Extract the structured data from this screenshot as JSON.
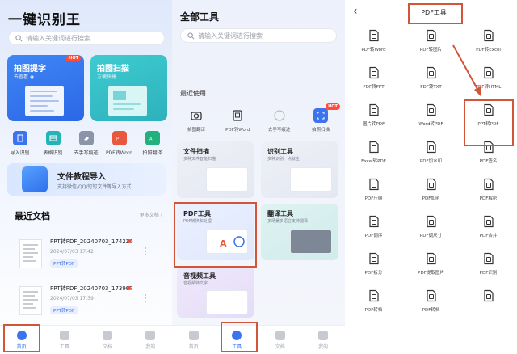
{
  "panel1": {
    "app_title": "一键识别王",
    "search_placeholder": "请输入关键词进行搜索",
    "card_photo": {
      "title": "拍图提字",
      "subtitle": "去查看 ◉",
      "badge": "HOT"
    },
    "card_scan": {
      "title": "拍图扫描",
      "subtitle": "方便快捷"
    },
    "tools": [
      {
        "label": "导入识别",
        "color": "#3b74ee"
      },
      {
        "label": "表格识别",
        "color": "#23b4b8"
      },
      {
        "label": "去手写痕迹",
        "color": "#8b94a8"
      },
      {
        "label": "PDF转Word",
        "color": "#e9573f"
      },
      {
        "label": "拍照翻译",
        "color": "#22b07d"
      }
    ],
    "banner": {
      "title": "文件教程导入",
      "subtitle": "支持微信/QQ/钉钉文件等导入方式"
    },
    "recent_title": "最近文档",
    "recent_more": "更多文档 ›",
    "files": [
      {
        "name": "PPT转PDF_20240703_174226",
        "date": "2024/07/03 17:42",
        "tag": "PPT转PDF"
      },
      {
        "name": "PPT转PDF_20240703_173907",
        "date": "2024/07/03 17:39",
        "tag": "PPT转PDF"
      }
    ],
    "tabs": [
      "首页",
      "工具",
      "文档",
      "我的"
    ]
  },
  "panel2": {
    "title": "全部工具",
    "search_placeholder": "请输入关键词进行搜索",
    "recent_label": "最近使用",
    "recent_tools": [
      {
        "label": "拍图翻译"
      },
      {
        "label": "PDF转Word"
      },
      {
        "label": "去手写痕迹"
      },
      {
        "label": "拍照扫描",
        "badge": "HOT"
      }
    ],
    "categories": [
      {
        "title": "文件扫描",
        "subtitle": "多种文件智能扫描"
      },
      {
        "title": "识别工具",
        "subtitle": "多种识别一点就全"
      },
      {
        "title": "PDF工具",
        "subtitle": "PDF转换和处理"
      },
      {
        "title": "翻译工具",
        "subtitle": "多场景多语言支持翻译"
      },
      {
        "title": "音视频工具",
        "subtitle": "音视频转文字"
      }
    ],
    "tabs": [
      "首页",
      "工具",
      "文档",
      "我的"
    ]
  },
  "panel3": {
    "back": "‹",
    "title": "PDF工具",
    "items": [
      "PDF转Word",
      "PDF转图片",
      "PDF转Excel",
      "PDF转PPT",
      "PDF转TXT",
      "PDF转HTML",
      "图片转PDF",
      "Word转PDF",
      "PPT转PDF",
      "Excel转PDF",
      "PDF加水印",
      "PDF签名",
      "PDF压缩",
      "PDF加密",
      "PDF解密",
      "PDF调序",
      "PDF调尺寸",
      "PDF合并",
      "PDF拆分",
      "PDF提取图片",
      "PDF识别",
      "PDF转档",
      "PDF转档",
      ""
    ]
  },
  "colors": {
    "accent": "#3b74ee",
    "highlight_box": "#d2553a",
    "hot": "#ff4d3a"
  }
}
